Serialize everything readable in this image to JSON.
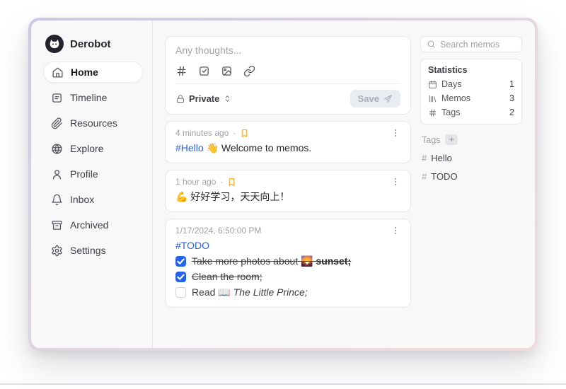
{
  "ui": {
    "dot": "·"
  },
  "sidebar": {
    "user": {
      "name": "Derobot",
      "avatar_icon": "cat-avatar"
    },
    "items": [
      {
        "label": "Home",
        "icon": "home-icon",
        "active": true
      },
      {
        "label": "Timeline",
        "icon": "timeline-icon",
        "active": false
      },
      {
        "label": "Resources",
        "icon": "paperclip-icon",
        "active": false
      },
      {
        "label": "Explore",
        "icon": "globe-icon",
        "active": false
      },
      {
        "label": "Profile",
        "icon": "user-icon",
        "active": false
      },
      {
        "label": "Inbox",
        "icon": "bell-icon",
        "active": false
      },
      {
        "label": "Archived",
        "icon": "archive-icon",
        "active": false
      },
      {
        "label": "Settings",
        "icon": "gear-icon",
        "active": false
      }
    ]
  },
  "editor": {
    "placeholder": "Any thoughts...",
    "toolbar_icons": [
      "hashtag-icon",
      "checkbox-icon",
      "image-icon",
      "link-icon"
    ],
    "visibility_label": "Private",
    "visibility_icon": "lock-icon",
    "visibility_chevron_icon": "chevrons-up-down-icon",
    "save_label": "Save",
    "save_icon": "send-icon"
  },
  "memos": [
    {
      "time": "4 minutes ago",
      "pinned_icon": "bookmark-icon",
      "menu_icon": "kebab-icon",
      "tag": "#Hello",
      "text": "👋 Welcome to memos."
    },
    {
      "time": "1 hour ago",
      "pinned_icon": "bookmark-icon",
      "menu_icon": "kebab-icon",
      "text": "💪 好好学习，天天向上！"
    },
    {
      "time": "1/17/2024, 6:50:00 PM",
      "menu_icon": "kebab-icon",
      "tag": "#TODO",
      "tasks": [
        {
          "checked": true,
          "text": "Take more photos about 🌄 ",
          "text_bold": "sunset;"
        },
        {
          "checked": true,
          "text": "Clean the room;"
        },
        {
          "checked": false,
          "text": "Read 📖 ",
          "text_italic": "The Little Prince;"
        }
      ]
    }
  ],
  "search": {
    "placeholder": "Search memos",
    "icon": "search-icon"
  },
  "statistics": {
    "title": "Statistics",
    "rows": [
      {
        "icon": "calendar-icon",
        "label": "Days",
        "value": "1"
      },
      {
        "icon": "library-icon",
        "label": "Memos",
        "value": "3"
      },
      {
        "icon": "hash-icon",
        "label": "Tags",
        "value": "2"
      }
    ]
  },
  "tags": {
    "title": "Tags",
    "add_label": "+",
    "hash_prefix": "#",
    "items": [
      {
        "label": "Hello"
      },
      {
        "label": "TODO"
      }
    ]
  },
  "colors": {
    "accent_blue": "#2563eb",
    "bookmark_orange": "#f59e0b",
    "checked_checkbox": "#2563eb",
    "frame_gradient_start": "#ccc8e5",
    "frame_gradient_end": "#eedadb"
  }
}
